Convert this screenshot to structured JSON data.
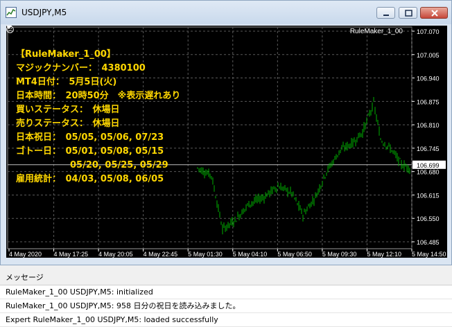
{
  "window": {
    "title": "USDJPY,M5"
  },
  "chart": {
    "ea_label": "RuleMaker_1_00",
    "info_lines": [
      "【RuleMaker_1_00】",
      "マジックナンバー：　4380100",
      "MT4日付：　5月5日(火)",
      "日本時間：　20時50分　※表示遅れあり",
      "買いステータス：　休場日",
      "売りステータス：　休場日",
      "日本祝日：　05/05, 05/06, 07/23",
      "ゴトー日：　05/01, 05/08, 05/15",
      "　　　　　　05/20, 05/25, 05/29",
      "雇用統計：　04/03, 05/08, 06/05"
    ],
    "price_ticks": [
      "107.070",
      "107.005",
      "106.940",
      "106.875",
      "106.810",
      "106.745",
      "106.680",
      "106.615",
      "106.550",
      "106.485"
    ],
    "current_price": "106.699",
    "time_ticks": [
      "4 May 2020",
      "4 May 17:25",
      "4 May 20:05",
      "4 May 22:45",
      "5 May 01:30",
      "5 May 04:10",
      "5 May 06:50",
      "5 May 09:30",
      "5 May 12:10",
      "5 May 14:50"
    ],
    "colors": {
      "background": "#000000",
      "candles": "#00b000",
      "text": "#ffd700",
      "grid": "#5a5a5a"
    }
  },
  "messages": {
    "header": "メッセージ",
    "rows": [
      "RuleMaker_1_00 USDJPY,M5: initialized",
      "RuleMaker_1_00 USDJPY,M5: 958 日分の祝日を読み込みました。",
      "Expert RuleMaker_1_00 USDJPY,M5: loaded successfully"
    ]
  }
}
